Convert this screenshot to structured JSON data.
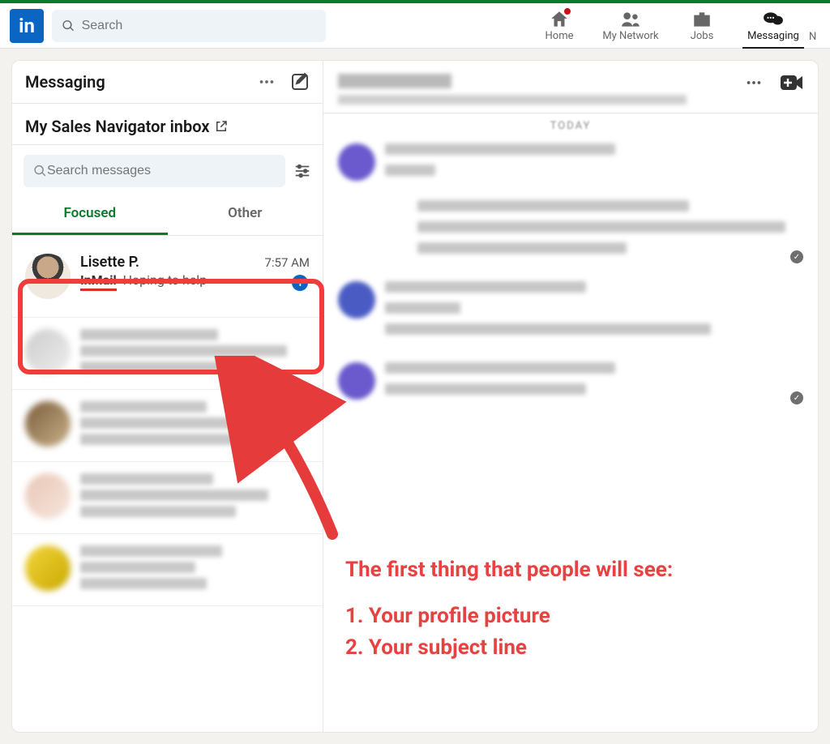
{
  "nav": {
    "search_placeholder": "Search",
    "items": [
      {
        "label": "Home"
      },
      {
        "label": "My Network"
      },
      {
        "label": "Jobs"
      },
      {
        "label": "Messaging"
      }
    ],
    "cut_label": "N"
  },
  "sidebar": {
    "title": "Messaging",
    "navinbox": "My Sales Navigator inbox",
    "search_placeholder": "Search messages",
    "tabs": {
      "focused": "Focused",
      "other": "Other"
    }
  },
  "message": {
    "name": "Lisette P.",
    "time": "7:57 AM",
    "inmail": "InMail",
    "subject": "Hoping to help",
    "unread_count": "1"
  },
  "conversation": {
    "today": "TODAY"
  },
  "annotation": {
    "headline": "The first thing that people will see:",
    "line1": "1. Your profile picture",
    "line2": "2. Your subject line"
  }
}
